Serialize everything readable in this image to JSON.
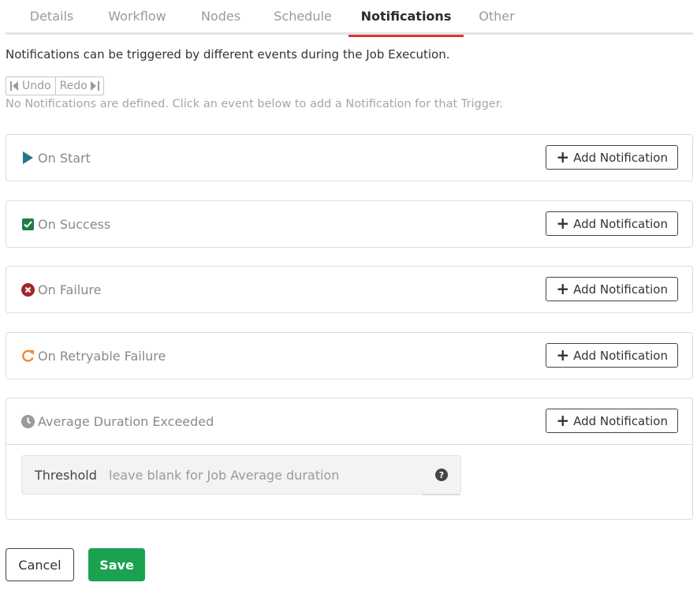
{
  "tabs": [
    {
      "label": "Details"
    },
    {
      "label": "Workflow"
    },
    {
      "label": "Nodes"
    },
    {
      "label": "Schedule"
    },
    {
      "label": "Notifications",
      "active": true
    },
    {
      "label": "Other"
    }
  ],
  "intro_text": "Notifications can be triggered by different events during the Job Execution.",
  "undo_label": "Undo",
  "redo_label": "Redo",
  "empty_message": "No Notifications are defined. Click an event below to add a Notification for that Trigger.",
  "add_notification_label": "Add Notification",
  "events": [
    {
      "label": "On Start",
      "icon": "play-icon",
      "color": "#1f7a8c"
    },
    {
      "label": "On Success",
      "icon": "check-square-icon",
      "color": "#1e7e46"
    },
    {
      "label": "On Failure",
      "icon": "times-circle-icon",
      "color": "#a3262a"
    },
    {
      "label": "On Retryable Failure",
      "icon": "redo-icon",
      "color": "#f0892b"
    },
    {
      "label": "Average Duration Exceeded",
      "icon": "clock-icon",
      "color": "#9a9a9a"
    }
  ],
  "threshold": {
    "label": "Threshold",
    "placeholder": "leave blank for Job Average duration",
    "value": ""
  },
  "buttons": {
    "cancel": "Cancel",
    "save": "Save"
  },
  "colors": {
    "active_tab_underline": "#d9363a",
    "save_green": "#1aa251"
  }
}
